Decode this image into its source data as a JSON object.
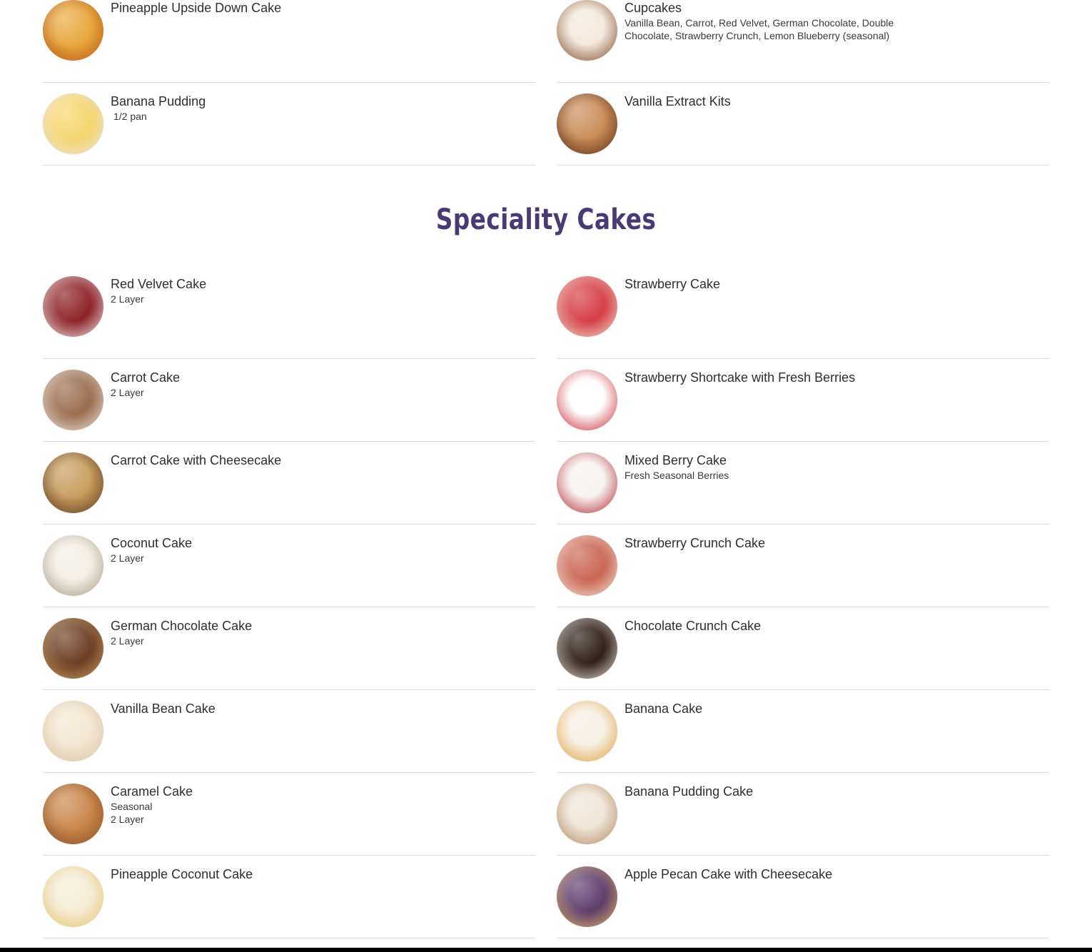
{
  "top_items": [
    {
      "name": "Pineapple Upside Down Cake",
      "desc": "",
      "c1": "#e8a63a",
      "c2": "#b85a16"
    },
    {
      "name": "Cupcakes",
      "desc": "Vanilla Bean, Carrot, Red Velvet, German Chocolate, Double Chocolate, Strawberry Crunch, Lemon Blueberry (seasonal)",
      "c1": "#f3e8dc",
      "c2": "#7a4a24"
    },
    {
      "name": "Banana Pudding",
      "desc": "1/2 pan",
      "c1": "#f6d56a",
      "c2": "#e8e2d8"
    },
    {
      "name": "Vanilla Extract Kits",
      "desc": "",
      "c1": "#c98a55",
      "c2": "#5a3018"
    }
  ],
  "section": {
    "title": "Speciality Cakes",
    "title_color": "#4a3a73"
  },
  "cakes": [
    {
      "name": "Red Velvet Cake",
      "desc": "2 Layer",
      "c1": "#8a1d24",
      "c2": "#f1ece8"
    },
    {
      "name": "Strawberry Cake",
      "desc": "",
      "c1": "#d53a40",
      "c2": "#efe2d4"
    },
    {
      "name": "Carrot Cake",
      "desc": "2 Layer",
      "c1": "#9a6a4a",
      "c2": "#eee6de"
    },
    {
      "name": "Strawberry Shortcake with Fresh Berries",
      "desc": "",
      "c1": "#ffffff",
      "c2": "#c8242e"
    },
    {
      "name": "Carrot Cake with Cheesecake",
      "desc": "",
      "c1": "#c89a5a",
      "c2": "#5a3a22"
    },
    {
      "name": "Mixed Berry Cake",
      "desc": "Fresh Seasonal Berries",
      "c1": "#f7f3f0",
      "c2": "#b22430"
    },
    {
      "name": "Coconut Cake",
      "desc": "2 Layer",
      "c1": "#f4efe6",
      "c2": "#a89a86"
    },
    {
      "name": "Strawberry Crunch Cake",
      "desc": "",
      "c1": "#c9634e",
      "c2": "#f3e8dc"
    },
    {
      "name": "German Chocolate Cake",
      "desc": "2 Layer",
      "c1": "#6a3a1e",
      "c2": "#c59a64"
    },
    {
      "name": "Chocolate Crunch Cake",
      "desc": "",
      "c1": "#2a1a12",
      "c2": "#e8e2da"
    },
    {
      "name": "Vanilla Bean Cake",
      "desc": "",
      "c1": "#f2e6d2",
      "c2": "#d8c4a0"
    },
    {
      "name": "Banana Cake",
      "desc": "",
      "c1": "#f6efe4",
      "c2": "#e0a03a"
    },
    {
      "name": "Caramel Cake",
      "desc": "Seasonal\n2 Layer",
      "c1": "#c98448",
      "c2": "#8a5228"
    },
    {
      "name": "Banana Pudding Cake",
      "desc": "",
      "c1": "#eee4d6",
      "c2": "#b08a60"
    },
    {
      "name": "Pineapple Coconut Cake",
      "desc": "",
      "c1": "#f4ecd6",
      "c2": "#e4c56a"
    },
    {
      "name": "Apple Pecan Cake with Cheesecake",
      "desc": "",
      "c1": "#5a3a6a",
      "c2": "#e0b46a"
    }
  ]
}
